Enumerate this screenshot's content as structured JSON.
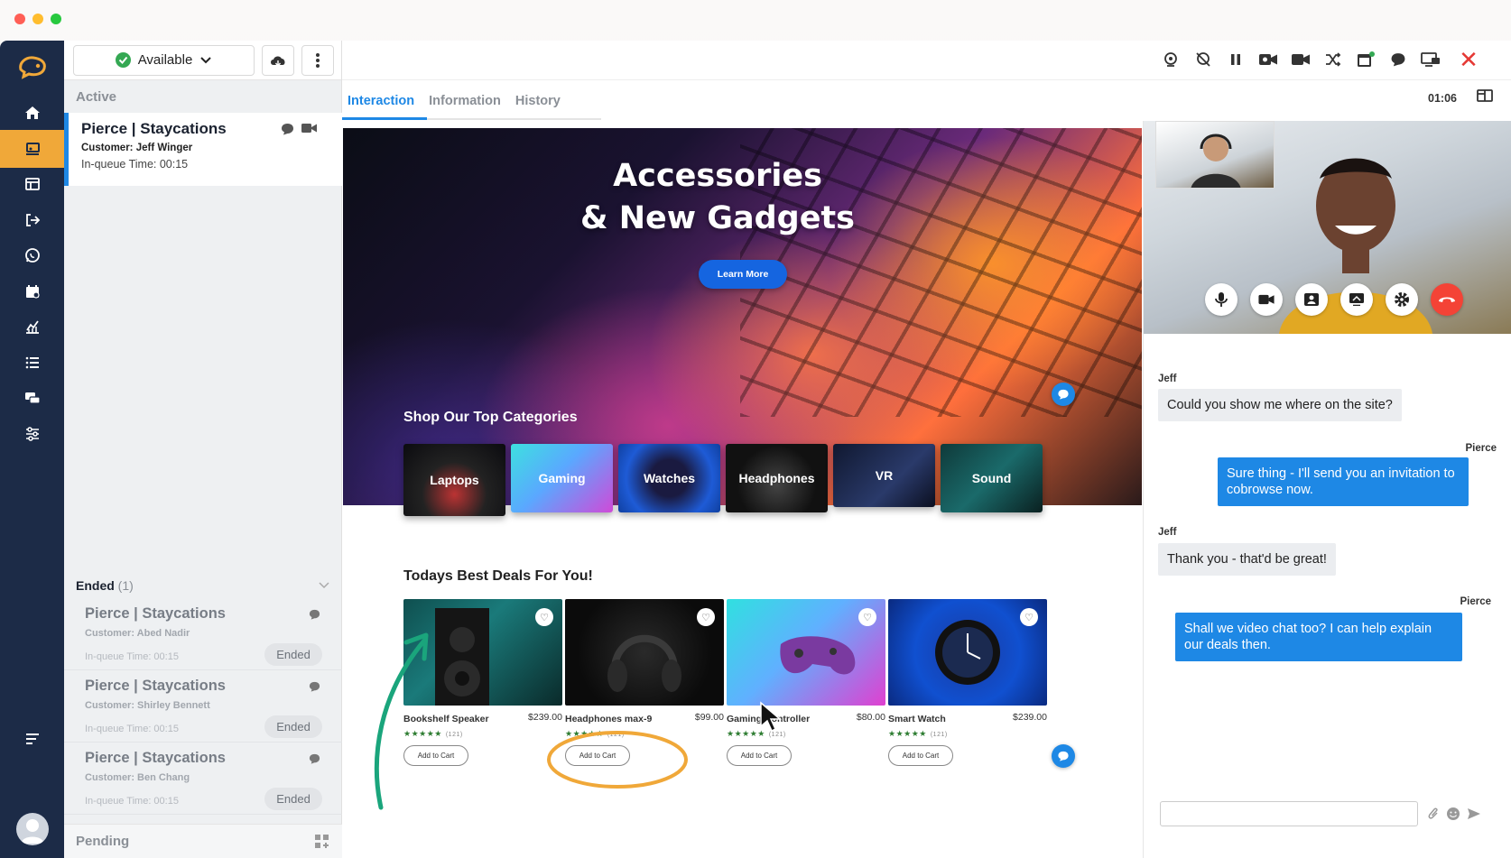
{
  "window": {
    "controls": [
      "close",
      "minimize",
      "maximize"
    ]
  },
  "colors": {
    "nav_bg": "#1c2b47",
    "nav_active": "#f0a839",
    "accent": "#1e88e5",
    "available": "#34a853",
    "danger": "#e53935"
  },
  "queue": {
    "status_label": "Available",
    "active_section": "Active",
    "active_card": {
      "title": "Pierce | Staycations",
      "customer": "Customer: Jeff Winger",
      "queue_time": "In-queue Time: 00:15"
    },
    "ended_section": "Ended",
    "ended_count": "(1)",
    "ended_cards": [
      {
        "title": "Pierce | Staycations",
        "customer": "Customer: Abed Nadir",
        "queue_time": "In-queue Time: 00:15",
        "badge": "Ended"
      },
      {
        "title": "Pierce | Staycations",
        "customer": "Customer: Shirley Bennett",
        "queue_time": "In-queue Time: 00:15",
        "badge": "Ended"
      },
      {
        "title": "Pierce | Staycations",
        "customer": "Customer: Ben Chang",
        "queue_time": "In-queue Time: 00:15",
        "badge": "Ended"
      }
    ],
    "pending_section": "Pending"
  },
  "toolbar": {
    "icons": [
      "webcam-icon",
      "webcam-off-icon",
      "pause-icon",
      "video-record-icon",
      "video-icon",
      "shuffle-icon",
      "calendar-icon",
      "chat-icon",
      "screen-share-icon",
      "close-icon"
    ]
  },
  "tabs": [
    {
      "label": "Interaction",
      "active": true
    },
    {
      "label": "Information",
      "active": false
    },
    {
      "label": "History",
      "active": false
    }
  ],
  "timer": "01:06",
  "site": {
    "hero_line1": "Accessories",
    "hero_line2": "& New Gadgets",
    "learn_more": "Learn More",
    "categories_title": "Shop Our Top Categories",
    "categories": [
      "Laptops",
      "Gaming",
      "Watches",
      "Headphones",
      "VR",
      "Sound"
    ],
    "deals_title": "Todays Best Deals For You!",
    "products": [
      {
        "name": "Bookshelf Speaker",
        "price": "$239.00",
        "reviews": "(121)",
        "cart": "Add to Cart"
      },
      {
        "name": "Headphones max-9",
        "price": "$99.00",
        "reviews": "(121)",
        "cart": "Add to Cart"
      },
      {
        "name": "Gaming Controller",
        "price": "$80.00",
        "reviews": "(121)",
        "cart": "Add to Cart"
      },
      {
        "name": "Smart Watch",
        "price": "$239.00",
        "reviews": "(121)",
        "cart": "Add to Cart"
      }
    ]
  },
  "chat": {
    "messages": [
      {
        "from": "Jeff",
        "text": "Could you show me where on the site?"
      },
      {
        "from": "Pierce",
        "text": "Sure thing - I'll send you an invitation to cobrowse now."
      },
      {
        "from": "Jeff",
        "text": "Thank you - that'd be great!"
      },
      {
        "from": "Pierce",
        "text": "Shall we video chat too? I can help explain our deals then."
      }
    ],
    "input_placeholder": ""
  }
}
